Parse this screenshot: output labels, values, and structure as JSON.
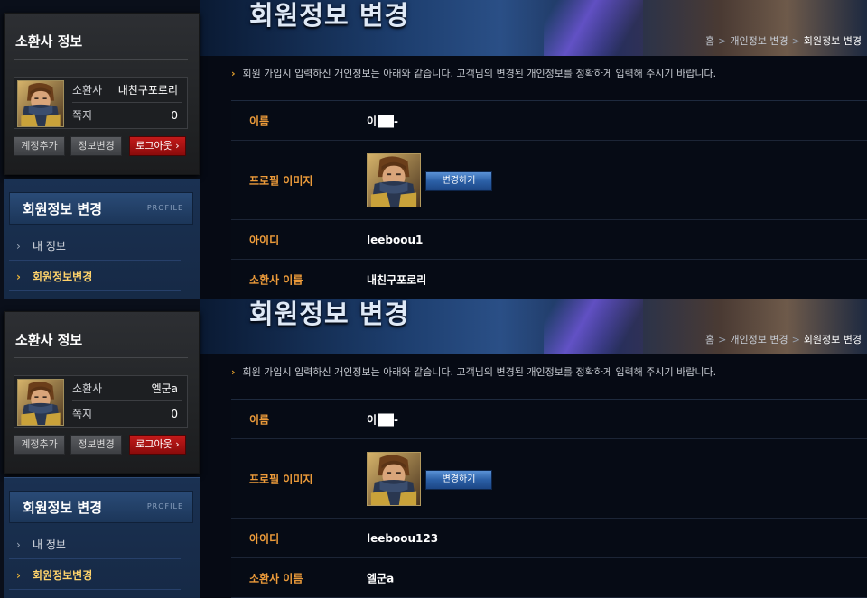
{
  "panels": [
    {
      "page_title": "회원정보 변경",
      "breadcrumb": [
        "홈",
        "개인정보 변경",
        "회원정보 변경"
      ],
      "sidebar": {
        "heading": "소환사 정보",
        "summoner_label": "소환사",
        "summoner_name": "내친구포로리",
        "message_label": "쪽지",
        "message_count": "0",
        "buttons": [
          "계정추가",
          "정보변경",
          "로그아웃 ›"
        ],
        "menu_title": "회원정보 변경",
        "menu_sub": "PROFILE",
        "menu_items": [
          "내 정보",
          "회원정보변경"
        ]
      },
      "intro": "회원 가입시 입력하신 개인정보는 아래와 같습니다. 고객님의 변경된 개인정보를 정확하게 입력해 주시기 바랍니다.",
      "form": {
        "name_label": "이름",
        "name_value": "이",
        "name_suffix": "-",
        "profile_label": "프로필 이미지",
        "change_button": "변경하기",
        "id_label": "아이디",
        "id_value": "leeboou1",
        "summoner_label": "소환사 이름",
        "summoner_value": "내친구포로리"
      }
    },
    {
      "page_title": "회원정보 변경",
      "breadcrumb": [
        "홈",
        "개인정보 변경",
        "회원정보 변경"
      ],
      "sidebar": {
        "heading": "소환사 정보",
        "summoner_label": "소환사",
        "summoner_name": "엘군a",
        "message_label": "쪽지",
        "message_count": "0",
        "buttons": [
          "계정추가",
          "정보변경",
          "로그아웃 ›"
        ],
        "menu_title": "회원정보 변경",
        "menu_sub": "PROFILE",
        "menu_items": [
          "내 정보",
          "회원정보변경"
        ]
      },
      "intro": "회원 가입시 입력하신 개인정보는 아래와 같습니다. 고객님의 변경된 개인정보를 정확하게 입력해 주시기 바랍니다.",
      "form": {
        "name_label": "이름",
        "name_value": "이",
        "name_suffix": "-",
        "profile_label": "프로필 이미지",
        "change_button": "변경하기",
        "id_label": "아이디",
        "id_value": "leeboou123",
        "summoner_label": "소환사 이름",
        "summoner_value": "엘군a"
      }
    }
  ],
  "icons": {
    "breadcrumb_separator": "chevron-right-icon",
    "menu_bullet": "chevron-right-icon",
    "intro_bullet": "chevron-right-icon",
    "avatar": "champion-portrait-icon"
  },
  "colors": {
    "accent_orange": "#ec9b3a",
    "logout_red": "#c31a1a",
    "change_button_blue": "#2b5fa6",
    "active_menu": "#ffd36b"
  }
}
